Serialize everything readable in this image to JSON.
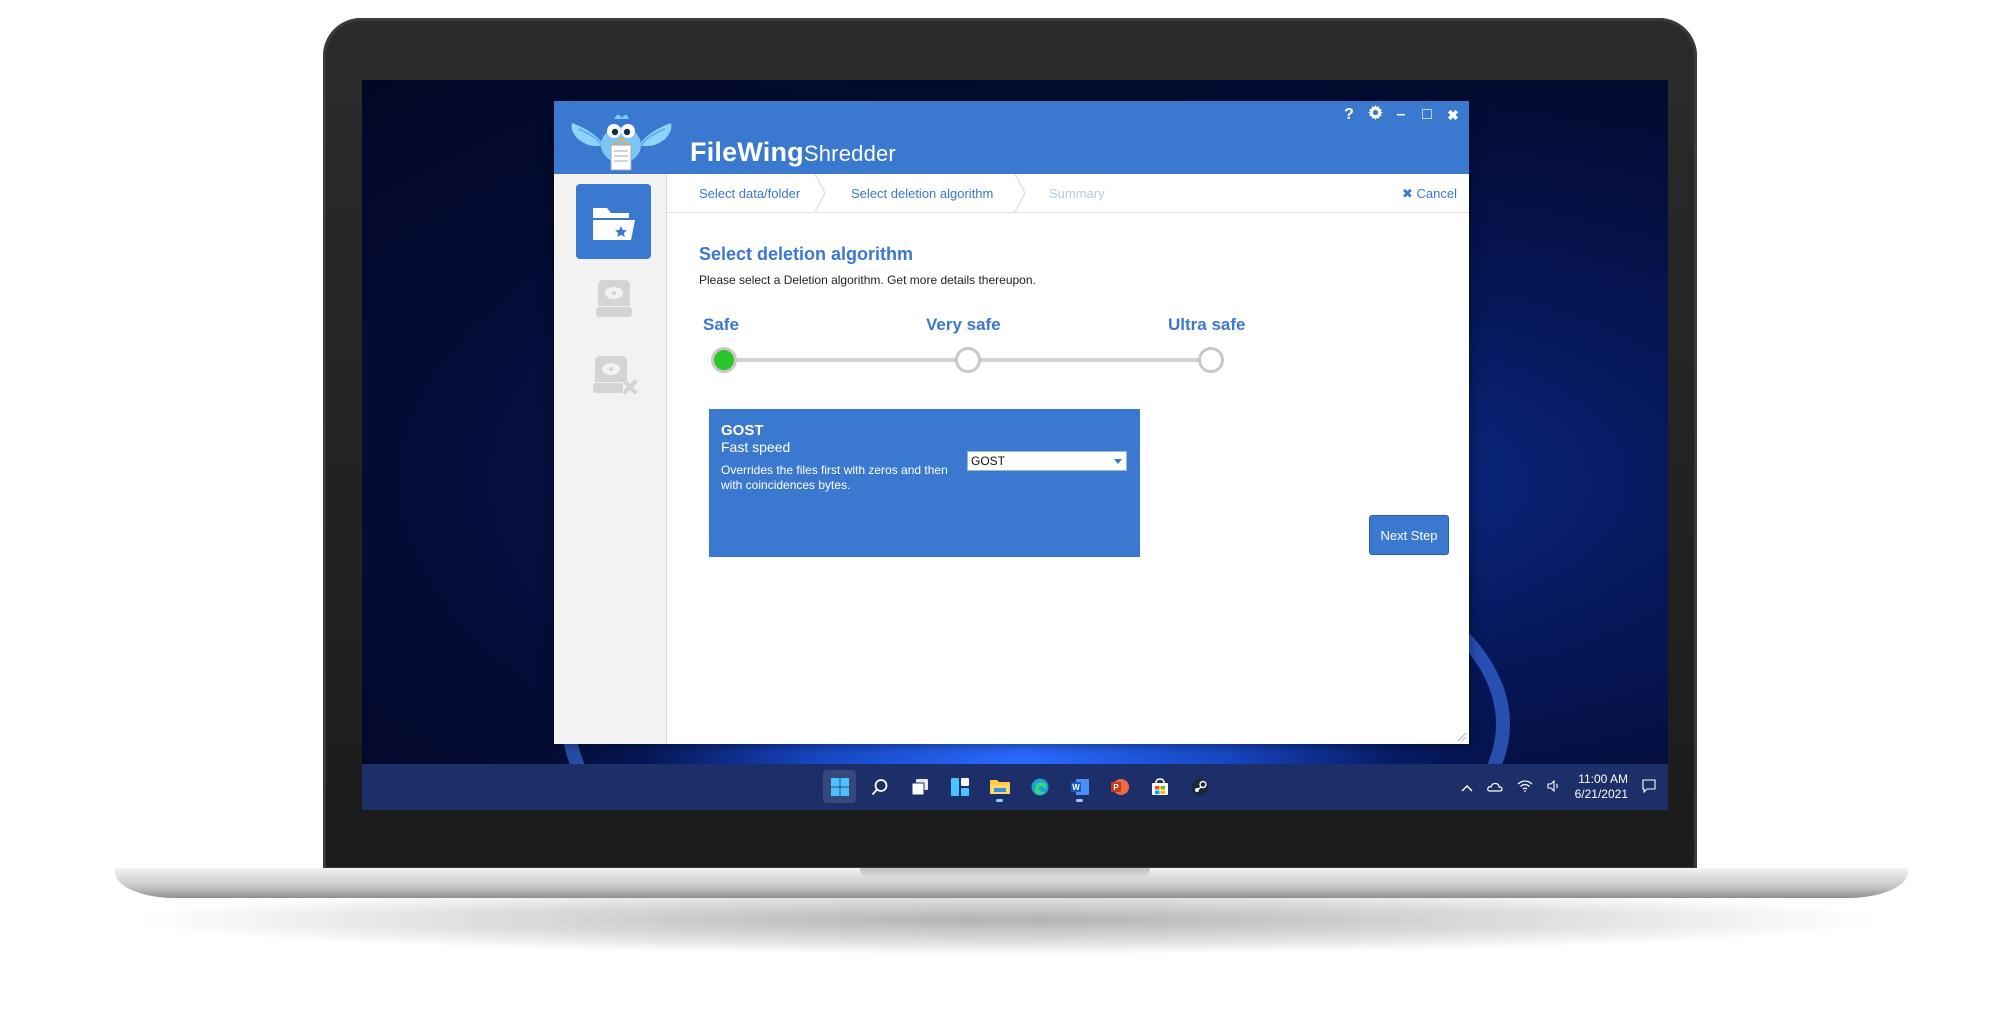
{
  "app": {
    "title_main": "FileWing",
    "title_sub": "Shredder",
    "controls": {
      "help": "?",
      "settings_icon": "gear-icon",
      "minimize": "–",
      "maximize": "□",
      "close": "✖"
    }
  },
  "steps": [
    {
      "label": "Select data/folder",
      "state": "done"
    },
    {
      "label": "Select deletion algorithm",
      "state": "current"
    },
    {
      "label": "Summary",
      "state": "disabled"
    }
  ],
  "cancel_label": "✖ Cancel",
  "main": {
    "title": "Select deletion algorithm",
    "description": "Please select a Deletion algorithm. Get more details thereupon.",
    "levels": [
      "Safe",
      "Very safe",
      "Ultra safe"
    ],
    "selected_level": "Safe"
  },
  "algorithm": {
    "name": "GOST",
    "speed": "Fast speed",
    "description": "Overrides the files first with zeros and then with coincidences bytes.",
    "selected_option": "GOST"
  },
  "next_button": "Next Step",
  "taskbar": {
    "icons": [
      "windows-start",
      "search",
      "task-view",
      "widgets",
      "file-explorer",
      "edge",
      "word",
      "powerpoint",
      "store",
      "steam"
    ],
    "time": "11:00 AM",
    "date": "6/21/2021"
  },
  "colors": {
    "accent": "#3b78cf",
    "selected_stop": "#2bc52b",
    "taskbar": "#1c2f68"
  }
}
